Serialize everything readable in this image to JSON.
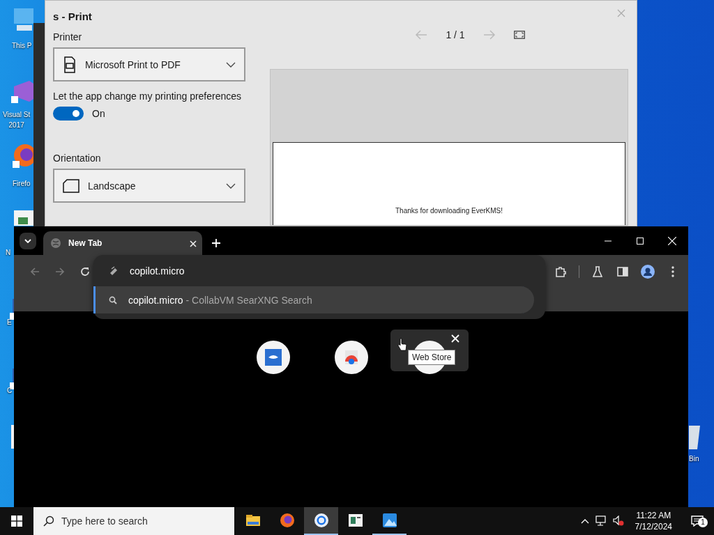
{
  "desktop_icons": [
    {
      "kind": "computer",
      "label": "This P"
    },
    {
      "kind": "vs",
      "label": "Visual St\n2017"
    },
    {
      "kind": "firefox",
      "label": "Firefo"
    },
    {
      "kind": "notepad",
      "label": "N"
    },
    {
      "kind": "shortcut",
      "label": "E"
    },
    {
      "kind": "shortcut",
      "label": "C"
    },
    {
      "kind": "document"
    },
    {
      "kind": "recycle",
      "label": "Bin"
    }
  ],
  "print_dialog": {
    "title": "s - Print",
    "printer_label": "Printer",
    "printer": "Microsoft Print to PDF",
    "preferences_label": "Let the app change my printing preferences",
    "preferences_toggle": {
      "on": true,
      "text": "On"
    },
    "orientation_label": "Orientation",
    "orientation": "Landscape",
    "page_indicator": "1 / 1",
    "preview_text": "Thanks for downloading EverKMS!"
  },
  "browser": {
    "tabs": [
      {
        "title": "New Tab",
        "selected": true
      }
    ],
    "address": "copilot.micro",
    "suggestions": [
      {
        "text": "copilot.micro",
        "description": "- CollabVM SearXNG Search",
        "selected": true
      }
    ],
    "shortcuts": [
      {
        "kind": "app-blue"
      },
      {
        "kind": "app-store"
      },
      {
        "kind": "blank",
        "hovered": true
      }
    ],
    "tooltip": "Web Store"
  },
  "taskbar": {
    "search_placeholder": "Type here to search",
    "apps": [
      {
        "kind": "folder",
        "selected": false,
        "running": false
      },
      {
        "kind": "firefox",
        "selected": false,
        "running": false
      },
      {
        "kind": "chrome",
        "selected": true,
        "running": true
      },
      {
        "kind": "notepad",
        "selected": false,
        "running": false
      },
      {
        "kind": "photos",
        "selected": false,
        "running": true
      }
    ],
    "time": "11:22 AM",
    "date": "7/12/2024",
    "notification_count": "1"
  }
}
